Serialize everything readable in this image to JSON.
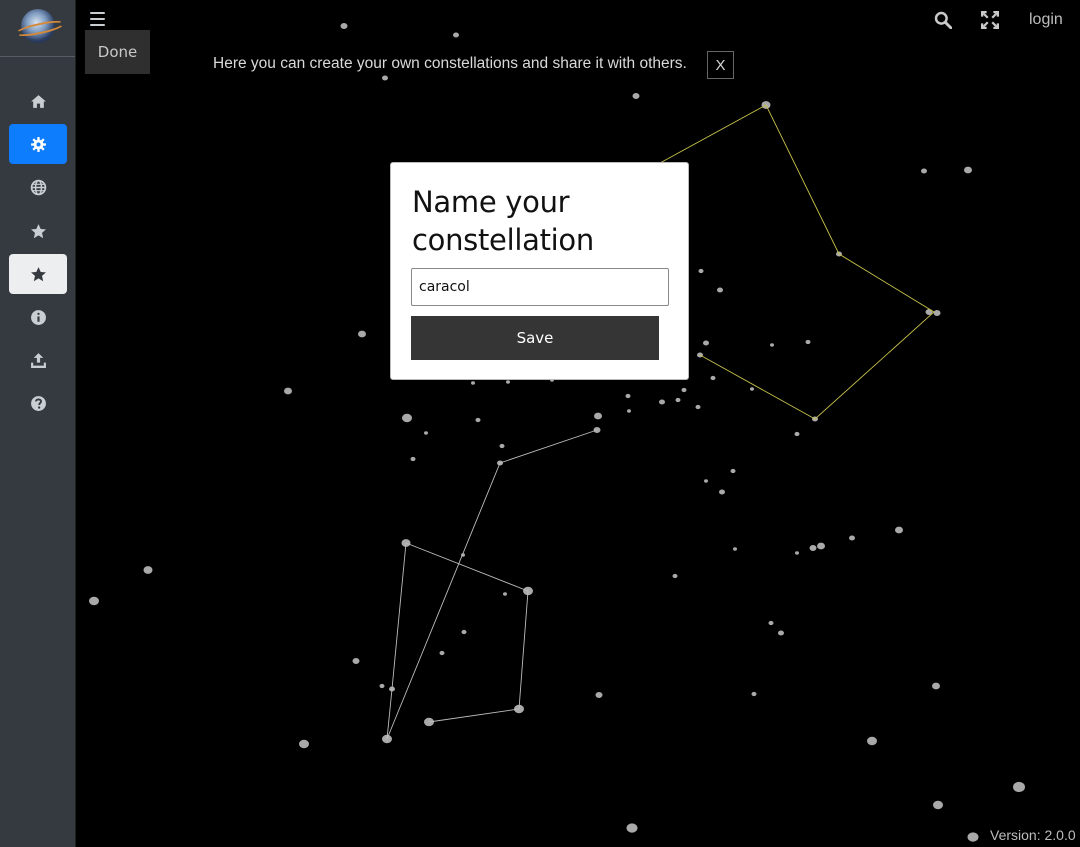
{
  "sidebar": {
    "items": [
      {
        "name": "home",
        "icon": "home-icon",
        "state": "normal"
      },
      {
        "name": "create-constellation",
        "icon": "gear-icon",
        "state": "active"
      },
      {
        "name": "globe",
        "icon": "globe-icon",
        "state": "normal"
      },
      {
        "name": "star",
        "icon": "star-icon",
        "state": "normal"
      },
      {
        "name": "my-constellations",
        "icon": "star-icon",
        "state": "highlighted"
      },
      {
        "name": "info",
        "icon": "info-icon",
        "state": "normal"
      },
      {
        "name": "upload",
        "icon": "upload-icon",
        "state": "normal"
      },
      {
        "name": "help",
        "icon": "question-icon",
        "state": "normal"
      }
    ],
    "active_color": "#0d7dfd"
  },
  "toolbar": {
    "done_label": "Done",
    "login_label": "login"
  },
  "info_banner": {
    "text": "Here you can create your own constellations and share it with others.",
    "close_label": "X"
  },
  "dialog": {
    "title": "Name your constellation",
    "input_value": "caracol",
    "save_label": "Save"
  },
  "footer": {
    "version": "Version: 2.0.0"
  }
}
